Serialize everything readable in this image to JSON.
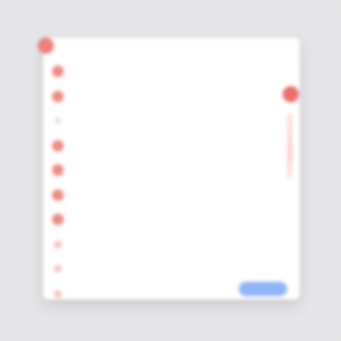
{
  "dialog": {
    "title": "",
    "badge_color": "#ec7f78"
  },
  "items": [
    {
      "icon": "red-circle-icon",
      "variant": "strong",
      "title": "",
      "subtitle": ""
    },
    {
      "icon": "red-circle-icon",
      "variant": "strong",
      "title": "",
      "subtitle": ""
    },
    {
      "icon": "blue-dot-icon",
      "variant": "blue",
      "title": "",
      "subtitle": ""
    },
    {
      "icon": "red-circle-icon",
      "variant": "strong",
      "title": "",
      "subtitle": ""
    },
    {
      "icon": "red-circle-icon",
      "variant": "strong",
      "title": "",
      "subtitle": ""
    },
    {
      "icon": "red-circle-icon",
      "variant": "strong",
      "title": "",
      "subtitle": ""
    },
    {
      "icon": "red-circle-icon",
      "variant": "strong",
      "title": "",
      "subtitle": ""
    },
    {
      "icon": "red-circle-icon",
      "variant": "light",
      "title": "",
      "subtitle": ""
    },
    {
      "icon": "red-circle-icon",
      "variant": "light",
      "title": "",
      "subtitle": ""
    },
    {
      "icon": "red-circle-icon",
      "variant": "light",
      "title": "",
      "subtitle": ""
    }
  ],
  "actions": {
    "primary_label": "",
    "secondary_label": ""
  },
  "colors": {
    "accent_red": "#ec7f78",
    "accent_blue": "#8fb4f7",
    "background": "#e6e6e8",
    "surface": "#ffffff"
  }
}
